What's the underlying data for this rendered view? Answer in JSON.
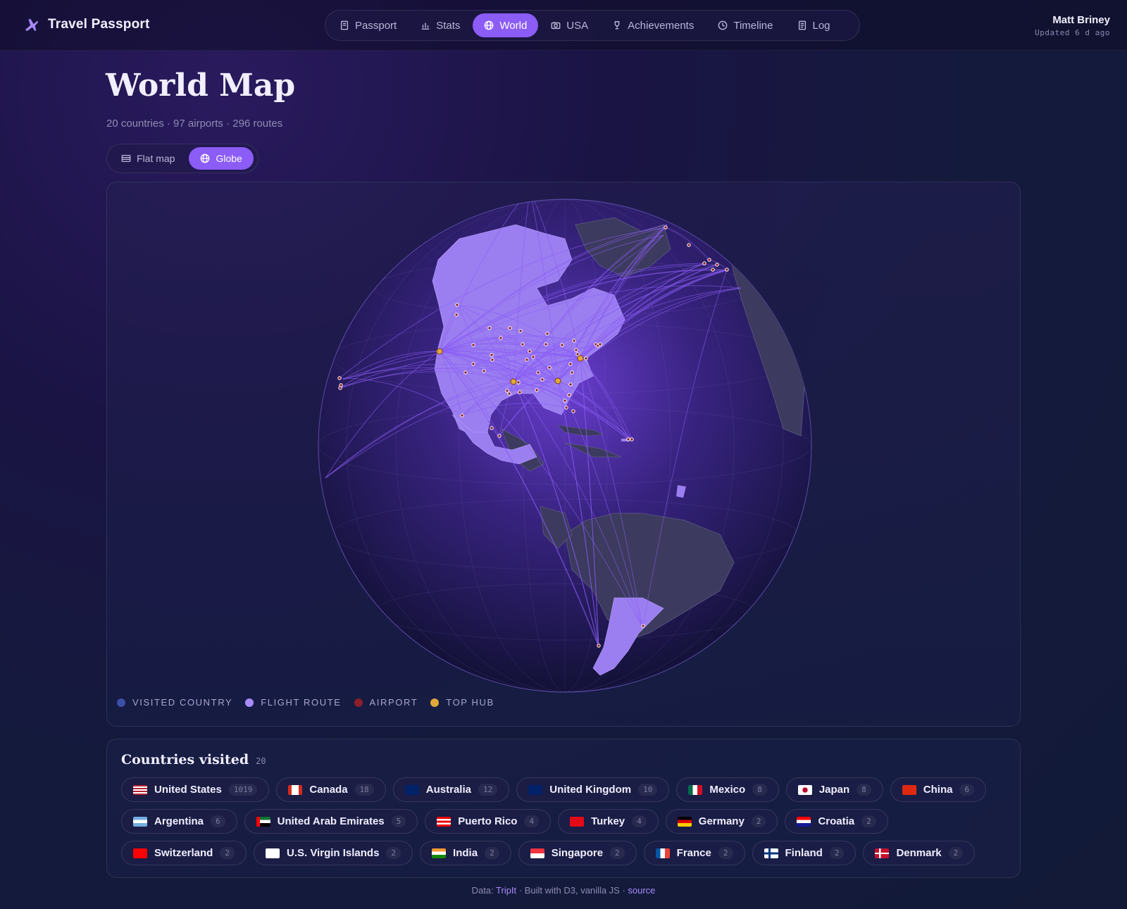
{
  "app": {
    "name": "Travel Passport"
  },
  "nav": [
    {
      "label": "Passport",
      "icon": "passport-icon",
      "active": false
    },
    {
      "label": "Stats",
      "icon": "bar-chart-icon",
      "active": false
    },
    {
      "label": "World",
      "icon": "globe-icon",
      "active": true
    },
    {
      "label": "USA",
      "icon": "camera-icon",
      "active": false
    },
    {
      "label": "Achievements",
      "icon": "trophy-icon",
      "active": false
    },
    {
      "label": "Timeline",
      "icon": "clock-icon",
      "active": false
    },
    {
      "label": "Log",
      "icon": "log-icon",
      "active": false
    }
  ],
  "user": {
    "name": "Matt Briney",
    "updated": "Updated 6 d ago"
  },
  "page": {
    "title": "World Map",
    "subtitle": "20 countries · 97 airports · 296 routes"
  },
  "view_toggle": {
    "flat_label": "Flat map",
    "globe_label": "Globe",
    "selected": "Globe"
  },
  "legend": [
    {
      "label": "VISITED COUNTRY",
      "color": "#3b4fa8"
    },
    {
      "label": "FLIGHT ROUTE",
      "color": "#a78bfa"
    },
    {
      "label": "AIRPORT",
      "color": "#8a1f2a"
    },
    {
      "label": "TOP HUB",
      "color": "#e0a83a"
    }
  ],
  "colors": {
    "accent": "#8b5cf6",
    "visited_land": "#9b7ef0",
    "unvisited_land": "#3c3a5e"
  },
  "countries": {
    "title": "Countries visited",
    "count": "20",
    "items": [
      {
        "name": "United States",
        "count": "1019",
        "flag": "us"
      },
      {
        "name": "Canada",
        "count": "18",
        "flag": "ca"
      },
      {
        "name": "Australia",
        "count": "12",
        "flag": "au"
      },
      {
        "name": "United Kingdom",
        "count": "10",
        "flag": "gb"
      },
      {
        "name": "Mexico",
        "count": "8",
        "flag": "mx"
      },
      {
        "name": "Japan",
        "count": "8",
        "flag": "jp"
      },
      {
        "name": "China",
        "count": "6",
        "flag": "cn"
      },
      {
        "name": "Argentina",
        "count": "6",
        "flag": "ar"
      },
      {
        "name": "United Arab Emirates",
        "count": "5",
        "flag": "ae"
      },
      {
        "name": "Puerto Rico",
        "count": "4",
        "flag": "pr"
      },
      {
        "name": "Turkey",
        "count": "4",
        "flag": "tr"
      },
      {
        "name": "Germany",
        "count": "2",
        "flag": "de"
      },
      {
        "name": "Croatia",
        "count": "2",
        "flag": "hr"
      },
      {
        "name": "Switzerland",
        "count": "2",
        "flag": "ch"
      },
      {
        "name": "U.S. Virgin Islands",
        "count": "2",
        "flag": "vi"
      },
      {
        "name": "India",
        "count": "2",
        "flag": "in"
      },
      {
        "name": "Singapore",
        "count": "2",
        "flag": "sg"
      },
      {
        "name": "France",
        "count": "2",
        "flag": "fr"
      },
      {
        "name": "Finland",
        "count": "2",
        "flag": "fi"
      },
      {
        "name": "Denmark",
        "count": "2",
        "flag": "dk"
      }
    ]
  },
  "footer": {
    "prefix": "Data: ",
    "data_link": "TripIt",
    "middle": " · Built with D3, vanilla JS · ",
    "source_link": "source"
  }
}
